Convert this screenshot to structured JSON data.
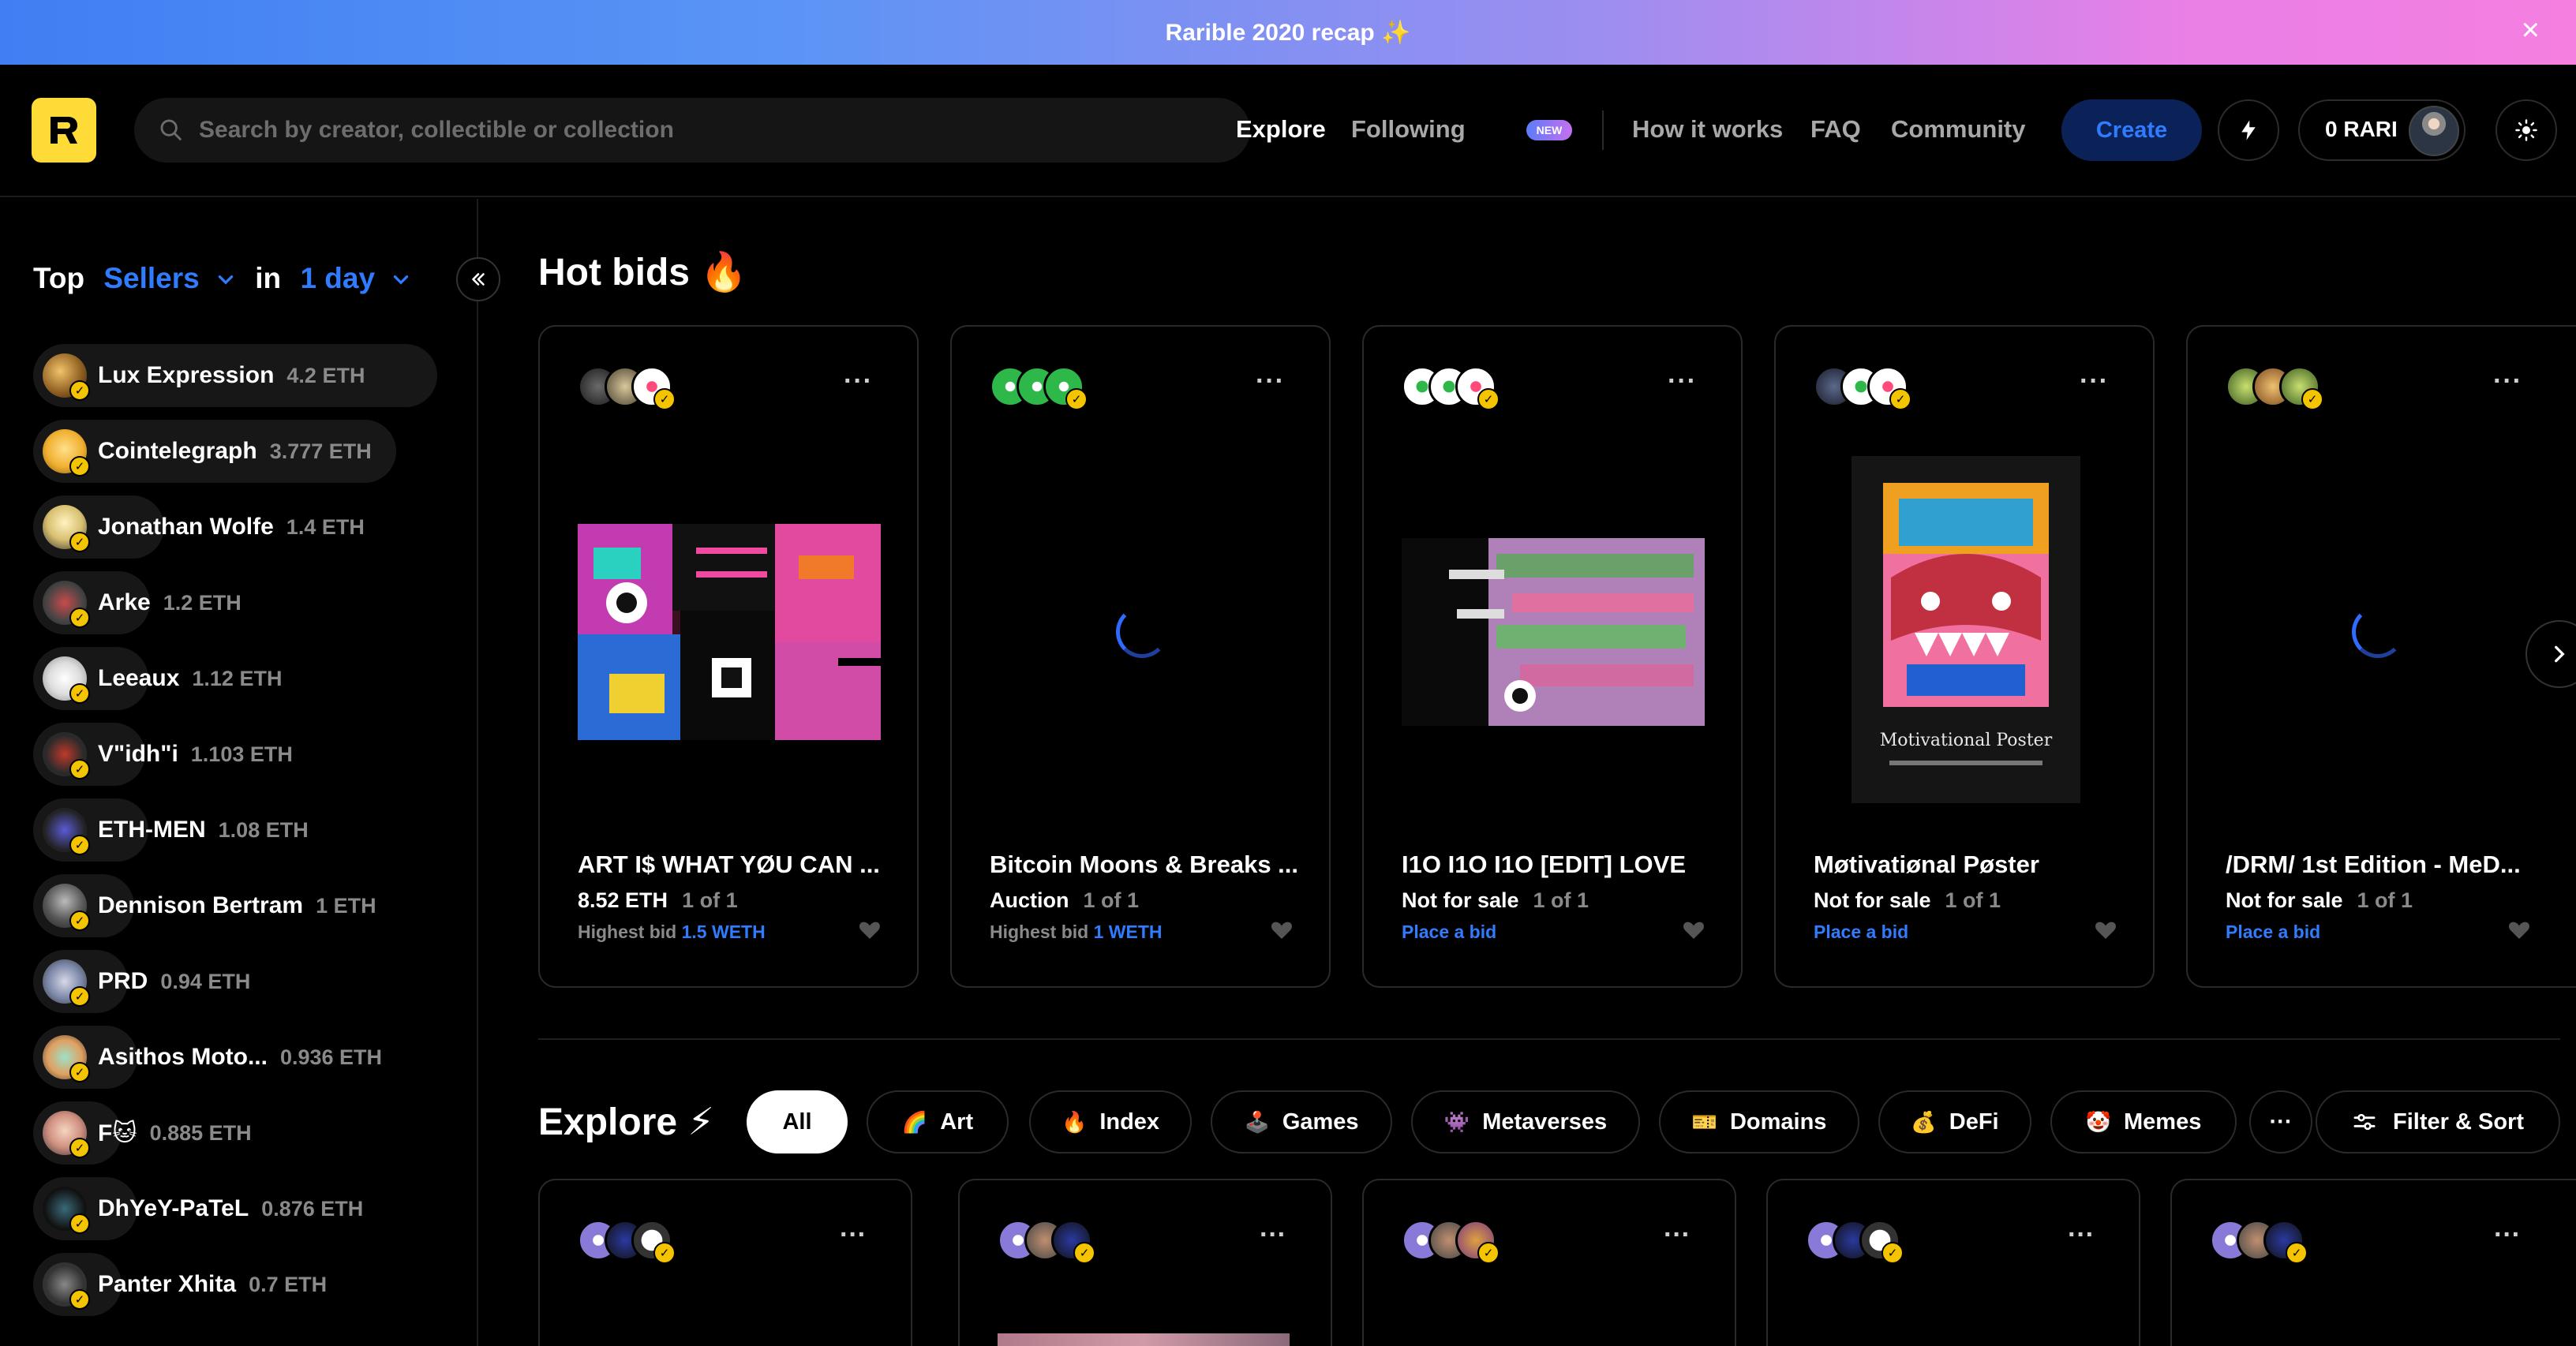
{
  "banner": {
    "text": "Rarible 2020 recap ✨",
    "close": "×"
  },
  "header": {
    "search_placeholder": "Search by creator, collectible or collection",
    "nav": {
      "explore": "Explore",
      "following": "Following",
      "new_badge": "NEW",
      "how_it_works": "How it works",
      "faq": "FAQ",
      "community": "Community"
    },
    "create": "Create",
    "rari": "0 RARI"
  },
  "sidebar": {
    "top": "Top",
    "category": "Sellers",
    "in": "in",
    "period": "1 day",
    "sellers": [
      {
        "name": "Lux Expression",
        "eth": "4.2 ETH"
      },
      {
        "name": "Cointelegraph",
        "eth": "3.777 ETH"
      },
      {
        "name": "Jonathan Wolfe",
        "eth": "1.4 ETH"
      },
      {
        "name": "Arke",
        "eth": "1.2 ETH"
      },
      {
        "name": "Leeaux",
        "eth": "1.12 ETH"
      },
      {
        "name": "V\"idh\"i",
        "eth": "1.103 ETH"
      },
      {
        "name": "ETH-MEN",
        "eth": "1.08 ETH"
      },
      {
        "name": "Dennison Bertram",
        "eth": "1 ETH"
      },
      {
        "name": "PRD",
        "eth": "0.94 ETH"
      },
      {
        "name": "Asithos Moto...",
        "eth": "0.936 ETH"
      },
      {
        "name": "F🐱",
        "eth": "0.885 ETH"
      },
      {
        "name": "DhYeY-PaTeL",
        "eth": "0.876 ETH"
      },
      {
        "name": "Panter Xhita",
        "eth": "0.7 ETH"
      }
    ]
  },
  "hot_bids": {
    "title": "Hot bids 🔥",
    "cards": [
      {
        "title": "ART I$ WHAT YØU CAN ...",
        "price": "8.52 ETH",
        "edition": "1 of 1",
        "bid_label": "Highest bid",
        "bid_value": "1.5 WETH",
        "link": ""
      },
      {
        "title": "Bitcoin Moons & Breaks ...",
        "price": "Auction",
        "edition": "1 of 1",
        "bid_label": "Highest bid",
        "bid_value": "1 WETH",
        "link": ""
      },
      {
        "title": "I1O I1O I1O [EDIT] LOVE",
        "price": "Not for sale",
        "edition": "1 of 1",
        "bid_label": "",
        "bid_value": "",
        "link": "Place a bid"
      },
      {
        "title": "Møtivatiønal Pøster",
        "price": "Not for sale",
        "edition": "1 of 1",
        "bid_label": "",
        "bid_value": "",
        "link": "Place a bid"
      },
      {
        "title": "/DRM/ 1st Edition - MeD...",
        "price": "Not for sale",
        "edition": "1 of 1",
        "bid_label": "",
        "bid_value": "",
        "link": "Place a bid"
      }
    ],
    "poster_title": "Motivational Poster"
  },
  "explore": {
    "title": "Explore ⚡",
    "chips": [
      {
        "label": "All",
        "emoji": ""
      },
      {
        "label": "Art",
        "emoji": "🌈"
      },
      {
        "label": "Index",
        "emoji": "🔥"
      },
      {
        "label": "Games",
        "emoji": "🕹️"
      },
      {
        "label": "Metaverses",
        "emoji": "👾"
      },
      {
        "label": "Domains",
        "emoji": "🎫"
      },
      {
        "label": "DeFi",
        "emoji": "💰"
      },
      {
        "label": "Memes",
        "emoji": "🤡"
      }
    ],
    "more": "···",
    "filter": "Filter & Sort"
  },
  "colors": {
    "accent": "#2f7cff",
    "verified": "#f5c400",
    "logo": "#fedb37",
    "create_bg": "#0b2259"
  }
}
